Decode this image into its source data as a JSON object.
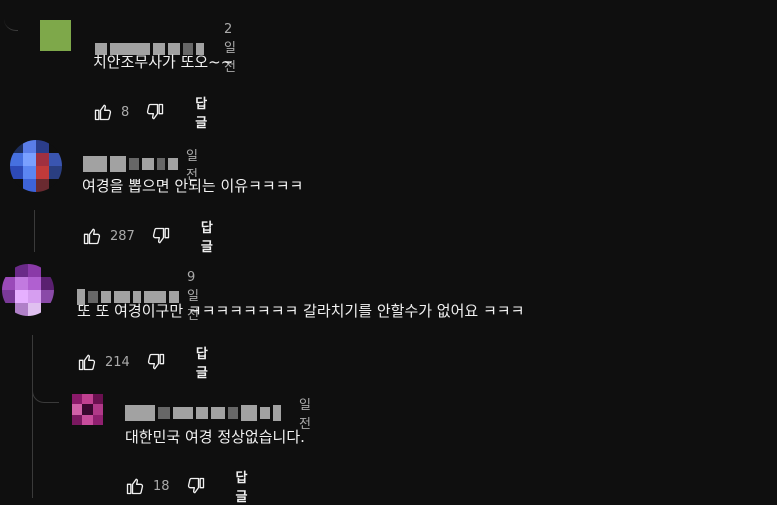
{
  "comments": [
    {
      "time": "2일 전",
      "text": "치안조무사가 또오~~",
      "likes": "8",
      "reply_label": "답글",
      "avatar_icon": "green-square-avatar",
      "avatar_color": "#7ea84a"
    },
    {
      "time": "일 전",
      "text": "여경을 뽑으면 안되는 이유ㅋㅋㅋㅋ",
      "likes": "287",
      "reply_label": "답글",
      "avatar_icon": "blue-pixel-avatar"
    },
    {
      "time": "9일 전",
      "text": "또 또 여경이구만 ㅋㅋㅋㅋㅋㅋㅋㅋ 갈라치기를 안할수가 없어요 ㅋㅋㅋ",
      "likes": "214",
      "reply_label": "답글",
      "avatar_icon": "purple-pixel-avatar"
    },
    {
      "time": "일 전",
      "text": "대한민국  여경 정상없습니다.",
      "likes": "18",
      "reply_label": "답글",
      "avatar_icon": "magenta-pixel-avatar"
    }
  ]
}
